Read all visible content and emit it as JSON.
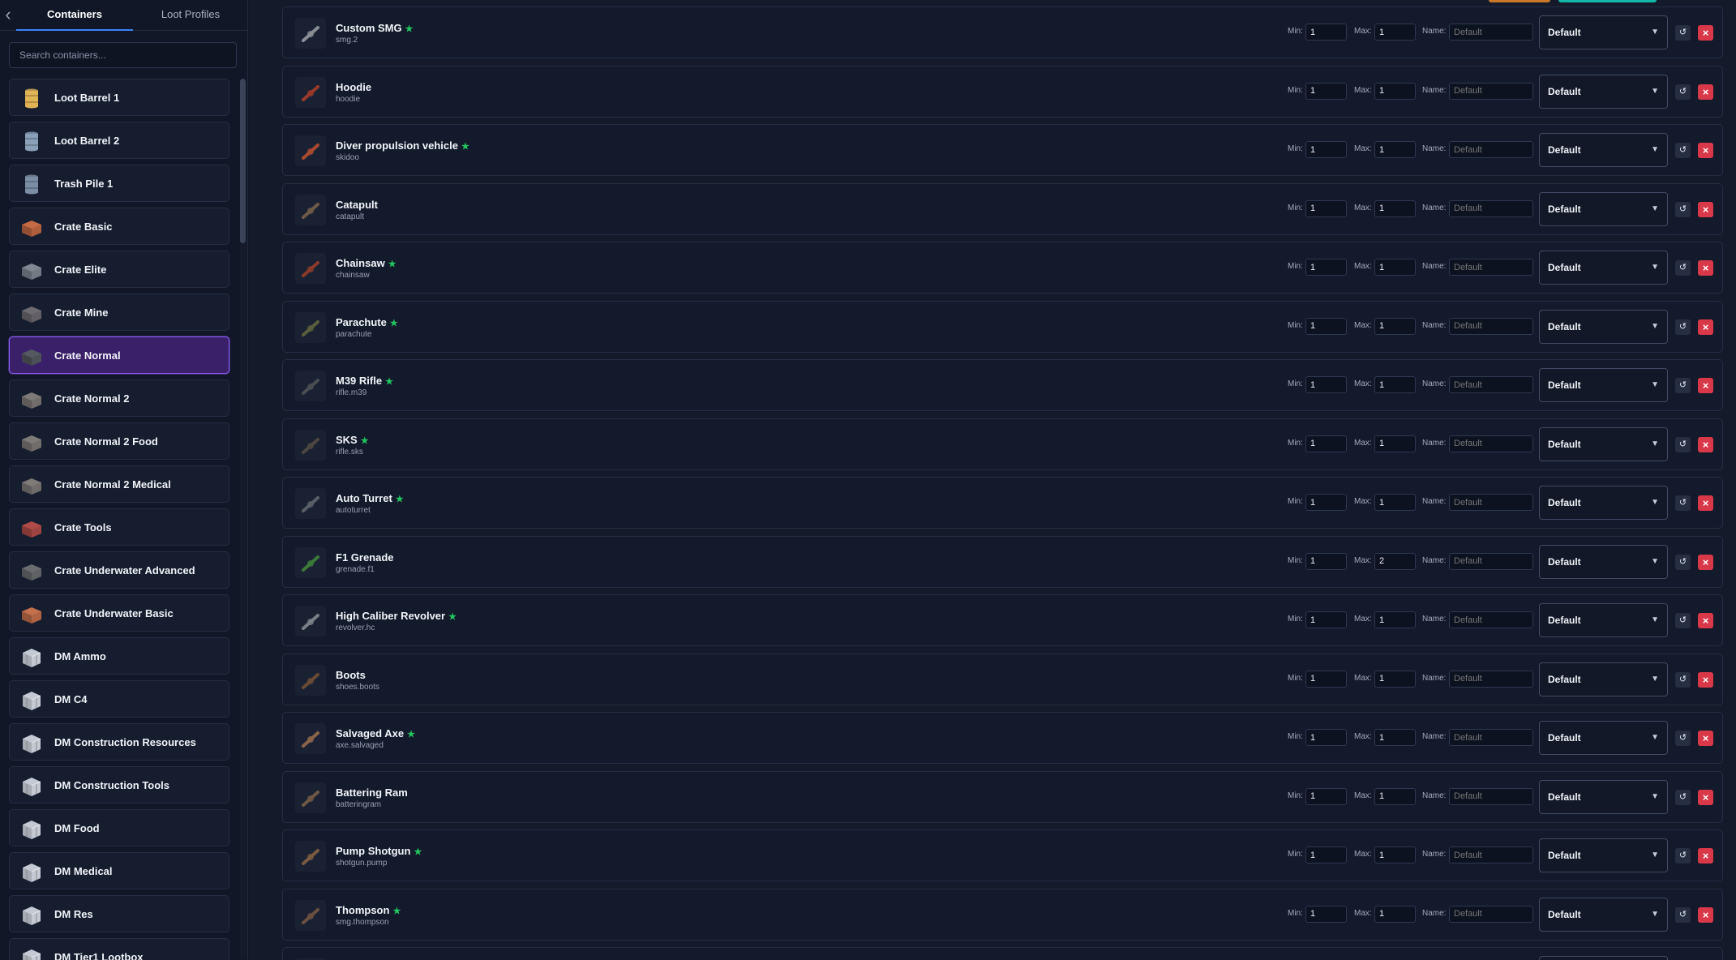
{
  "sidebar": {
    "back_icon": "chevron-left-icon",
    "tabs": [
      {
        "label": "Containers",
        "active": true
      },
      {
        "label": "Loot Profiles",
        "active": false
      }
    ],
    "search": {
      "placeholder": "Search containers..."
    },
    "containers": [
      {
        "label": "Loot Barrel 1",
        "icon": "barrel-icon",
        "color": "#e0b455"
      },
      {
        "label": "Loot Barrel 2",
        "icon": "barrel-icon",
        "color": "#8aa0b8"
      },
      {
        "label": "Trash Pile 1",
        "icon": "barrel-icon",
        "color": "#7c8ea6"
      },
      {
        "label": "Crate Basic",
        "icon": "crate-icon",
        "color": "#c46a45"
      },
      {
        "label": "Crate Elite",
        "icon": "crate-icon",
        "color": "#808894"
      },
      {
        "label": "Crate Mine",
        "icon": "crate-icon",
        "color": "#6e6a72"
      },
      {
        "label": "Crate Normal",
        "icon": "crate-icon",
        "color": "#555a61",
        "active": true
      },
      {
        "label": "Crate Normal 2",
        "icon": "crate-icon",
        "color": "#7e7a78"
      },
      {
        "label": "Crate Normal 2 Food",
        "icon": "crate-icon",
        "color": "#7e7a78"
      },
      {
        "label": "Crate Normal 2 Medical",
        "icon": "crate-icon",
        "color": "#7e7a78"
      },
      {
        "label": "Crate Tools",
        "icon": "crate-icon",
        "color": "#b04c48"
      },
      {
        "label": "Crate Underwater Advanced",
        "icon": "crate-icon",
        "color": "#6a6c70"
      },
      {
        "label": "Crate Underwater Basic",
        "icon": "crate-icon",
        "color": "#c4704c"
      },
      {
        "label": "DM Ammo",
        "icon": "dm-crate-icon",
        "color": "#c4c9d4"
      },
      {
        "label": "DM C4",
        "icon": "dm-crate-icon",
        "color": "#c4c9d4"
      },
      {
        "label": "DM Construction Resources",
        "icon": "dm-crate-icon",
        "color": "#c4c9d4"
      },
      {
        "label": "DM Construction Tools",
        "icon": "dm-crate-icon",
        "color": "#c4c9d4"
      },
      {
        "label": "DM Food",
        "icon": "dm-crate-icon",
        "color": "#c4c9d4"
      },
      {
        "label": "DM Medical",
        "icon": "dm-crate-icon",
        "color": "#c4c9d4"
      },
      {
        "label": "DM Res",
        "icon": "dm-crate-icon",
        "color": "#c4c9d4"
      },
      {
        "label": "DM Tier1 Lootbox",
        "icon": "dm-crate-icon",
        "color": "#c4c9d4"
      }
    ]
  },
  "items": [
    {
      "name": "Custom SMG",
      "short": "smg.2",
      "starred": true,
      "min": "1",
      "max": "1",
      "name_placeholder": "Default",
      "profile": "Default",
      "icon": "smg-icon",
      "color": "#8a8d94"
    },
    {
      "name": "Hoodie",
      "short": "hoodie",
      "starred": false,
      "min": "1",
      "max": "1",
      "name_placeholder": "Default",
      "profile": "Default",
      "icon": "hoodie-icon",
      "color": "#9a3a2c"
    },
    {
      "name": "Diver propulsion vehicle",
      "short": "skidoo",
      "starred": true,
      "min": "1",
      "max": "1",
      "name_placeholder": "Default",
      "profile": "Default",
      "icon": "skidoo-icon",
      "color": "#a84a2e"
    },
    {
      "name": "Catapult",
      "short": "catapult",
      "starred": false,
      "min": "1",
      "max": "1",
      "name_placeholder": "Default",
      "profile": "Default",
      "icon": "catapult-icon",
      "color": "#6e5a48"
    },
    {
      "name": "Chainsaw",
      "short": "chainsaw",
      "starred": true,
      "min": "1",
      "max": "1",
      "name_placeholder": "Default",
      "profile": "Default",
      "icon": "chainsaw-icon",
      "color": "#8a3a2a"
    },
    {
      "name": "Parachute",
      "short": "parachute",
      "starred": true,
      "min": "1",
      "max": "1",
      "name_placeholder": "Default",
      "profile": "Default",
      "icon": "parachute-icon",
      "color": "#5a5e3c"
    },
    {
      "name": "M39 Rifle",
      "short": "rifle.m39",
      "starred": true,
      "min": "1",
      "max": "1",
      "name_placeholder": "Default",
      "profile": "Default",
      "icon": "rifle-icon",
      "color": "#4a4d52"
    },
    {
      "name": "SKS",
      "short": "rifle.sks",
      "starred": true,
      "min": "1",
      "max": "1",
      "name_placeholder": "Default",
      "profile": "Default",
      "icon": "rifle-icon",
      "color": "#4e4640"
    },
    {
      "name": "Auto Turret",
      "short": "autoturret",
      "starred": true,
      "min": "1",
      "max": "1",
      "name_placeholder": "Default",
      "profile": "Default",
      "icon": "turret-icon",
      "color": "#5a5e66"
    },
    {
      "name": "F1 Grenade",
      "short": "grenade.f1",
      "starred": false,
      "min": "1",
      "max": "2",
      "name_placeholder": "Default",
      "profile": "Default",
      "icon": "grenade-icon",
      "color": "#3c7a3a"
    },
    {
      "name": "High Caliber Revolver",
      "short": "revolver.hc",
      "starred": true,
      "min": "1",
      "max": "1",
      "name_placeholder": "Default",
      "profile": "Default",
      "icon": "revolver-icon",
      "color": "#7a7e86"
    },
    {
      "name": "Boots",
      "short": "shoes.boots",
      "starred": false,
      "min": "1",
      "max": "1",
      "name_placeholder": "Default",
      "profile": "Default",
      "icon": "boots-icon",
      "color": "#6a4a34"
    },
    {
      "name": "Salvaged Axe",
      "short": "axe.salvaged",
      "starred": true,
      "min": "1",
      "max": "1",
      "name_placeholder": "Default",
      "profile": "Default",
      "icon": "axe-icon",
      "color": "#8a6448"
    },
    {
      "name": "Battering Ram",
      "short": "batteringram",
      "starred": false,
      "min": "1",
      "max": "1",
      "name_placeholder": "Default",
      "profile": "Default",
      "icon": "ram-icon",
      "color": "#6e5844"
    },
    {
      "name": "Pump Shotgun",
      "short": "shotgun.pump",
      "starred": true,
      "min": "1",
      "max": "1",
      "name_placeholder": "Default",
      "profile": "Default",
      "icon": "shotgun-icon",
      "color": "#7a5a40"
    },
    {
      "name": "Thompson",
      "short": "smg.thompson",
      "starred": true,
      "min": "1",
      "max": "1",
      "name_placeholder": "Default",
      "profile": "Default",
      "icon": "smg-icon",
      "color": "#6a5040"
    },
    {
      "name": "",
      "short": "",
      "starred": false,
      "min": "",
      "max": "",
      "name_placeholder": "",
      "profile": "",
      "icon": "item-icon",
      "color": "#555a61"
    }
  ],
  "labels": {
    "min": "Min:",
    "max": "Max:",
    "name": "Name:"
  },
  "icons": {
    "dropdown": "chevron-down-icon",
    "refresh": "refresh-icon",
    "remove": "close-icon",
    "star": "star-icon"
  },
  "colors": {
    "accent": "#8b5cf6",
    "tab_indicator": "#3b82f6",
    "remove": "#d93849",
    "star": "#22c55e",
    "top_orange": "#c9782a",
    "top_teal": "#14b8a6"
  }
}
